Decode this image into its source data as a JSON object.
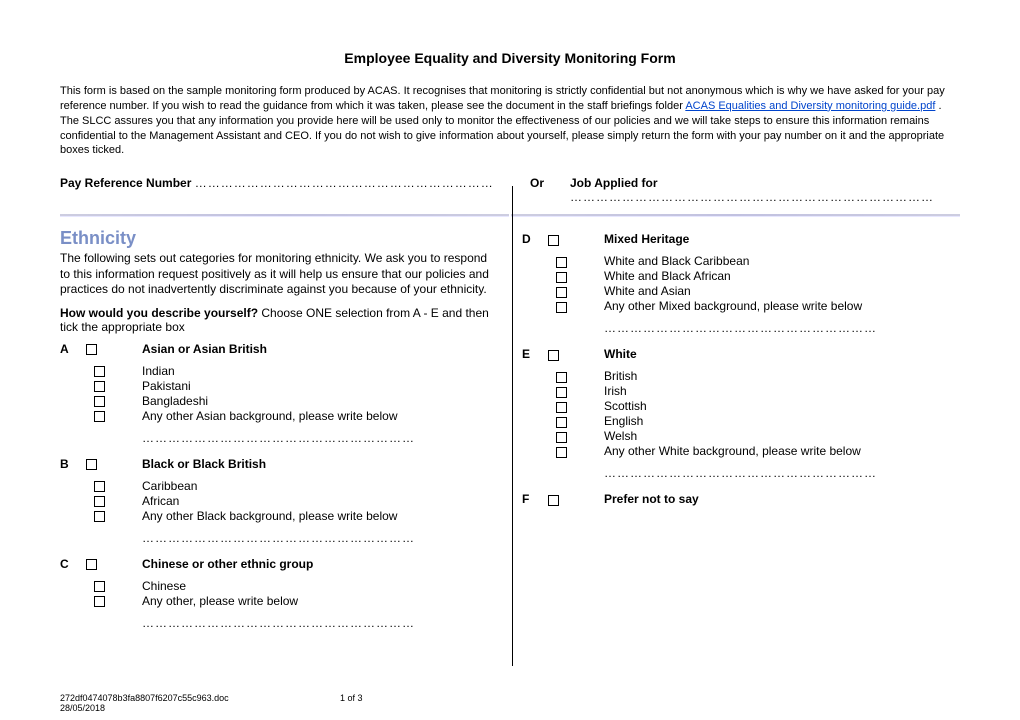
{
  "title": "Employee Equality and Diversity Monitoring Form",
  "intro_parts": {
    "p1": "This form is based on the sample monitoring form produced by ACAS.  It recognises that monitoring is strictly confidential but not anonymous which is why we have asked for your pay reference number.  If you wish to read the guidance from which it was taken, please see the document in the staff briefings folder ",
    "link": "ACAS Equalities and Diversity monitoring guide.pdf",
    "p2": " . The SLCC assures you that any information you provide here will be used only to monitor the effectiveness of our policies and we will take steps to ensure this information remains confidential to the Management Assistant and CEO. If you do not wish to give information about yourself, please simply return the form with your pay number on it and the appropriate boxes ticked."
  },
  "ref": {
    "pay_label": "Pay Reference Number",
    "or_label": "Or",
    "job_label": "Job Applied for"
  },
  "section": {
    "heading": "Ethnicity",
    "blurb": "The following sets out categories for monitoring ethnicity. We ask you to respond to this information request positively as it will help us ensure that our policies and practices do not inadvertently discriminate against you because of your ethnicity.",
    "question_bold": "How would you describe yourself?",
    "question_rest": " Choose ONE selection from A - E and then tick the appropriate box"
  },
  "groups": {
    "A": {
      "title": "Asian or Asian British",
      "opts": [
        "Indian",
        "Pakistani",
        "Bangladeshi",
        "Any other Asian background, please write below"
      ],
      "write": true
    },
    "B": {
      "title": "Black or Black British",
      "opts": [
        "Caribbean",
        "African",
        "Any other Black background, please write below"
      ],
      "write": true
    },
    "C": {
      "title": "Chinese or other ethnic group",
      "opts": [
        "Chinese",
        "Any other, please write below"
      ],
      "write": true
    },
    "D": {
      "title": "Mixed Heritage",
      "opts": [
        "White and Black Caribbean",
        "White and Black African",
        "White and Asian",
        "Any other Mixed background, please write below"
      ],
      "write": true
    },
    "E": {
      "title": "White",
      "opts": [
        "British",
        "Irish",
        "Scottish",
        "English",
        "Welsh",
        "Any other White background, please write below"
      ],
      "write": true
    },
    "F": {
      "title": "Prefer not to say",
      "opts": [],
      "write": false
    }
  },
  "dots_short": "……………………………………………………………",
  "dots_med": "………………………………………………………",
  "dots_long": "…………………………………………………………………………",
  "footer": {
    "file": "272df0474078b3fa8807f6207c55c963.doc",
    "date": "28/05/2018",
    "page": "1 of 3"
  }
}
